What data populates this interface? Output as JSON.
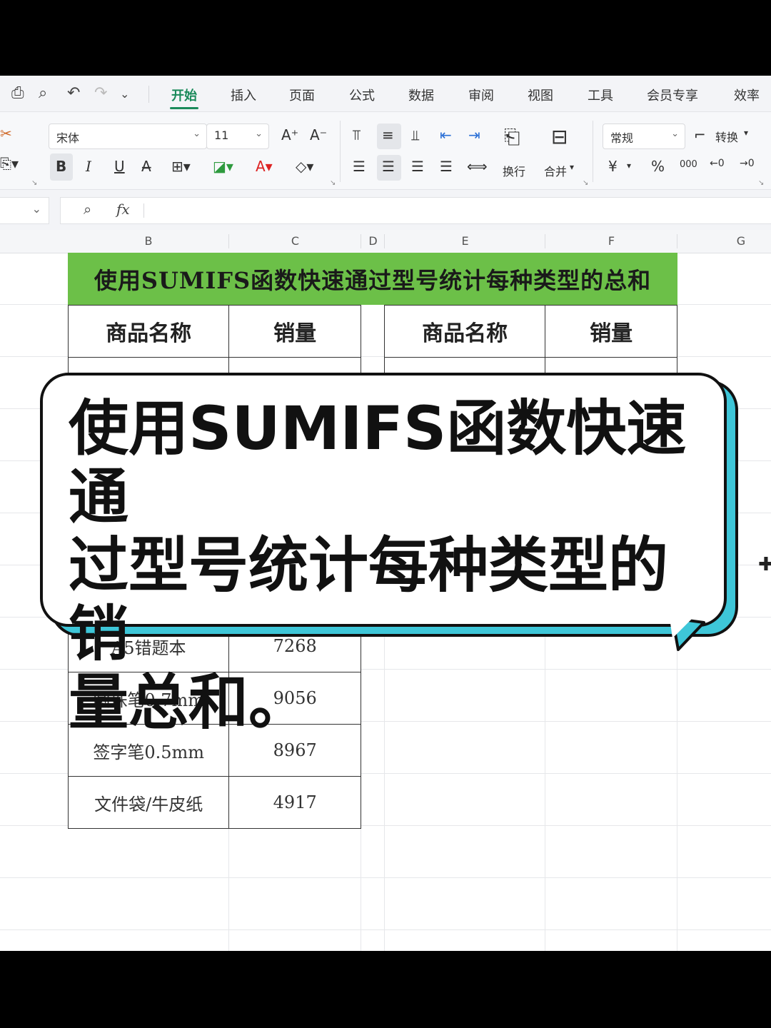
{
  "menu": {
    "tabs": [
      "开始",
      "插入",
      "页面",
      "公式",
      "数据",
      "审阅",
      "视图",
      "工具",
      "会员专享",
      "效率"
    ],
    "active_tab": "开始"
  },
  "ribbon": {
    "font_name": "宋体",
    "font_size": "11",
    "bold": "B",
    "italic": "I",
    "underline": "U",
    "wrap_label": "换行",
    "merge_label": "合并",
    "number_format": "常规",
    "convert_label": "转换",
    "currency": "¥",
    "percent": "%",
    "thousands": "000"
  },
  "formula_bar": {
    "fx_label": "fx",
    "value": ""
  },
  "columns": [
    "B",
    "C",
    "D",
    "E",
    "F",
    "G"
  ],
  "sheet": {
    "title": "使用SUMIFS函数快速通过型号统计每种类型的总和",
    "left_table": {
      "headers": [
        "商品名称",
        "销量"
      ],
      "rows": [
        [
          "A5错题本",
          "7268"
        ],
        [
          "圆珠笔0.7mm",
          "9056"
        ],
        [
          "签字笔0.5mm",
          "8967"
        ],
        [
          "文件袋/牛皮纸",
          "4917"
        ]
      ]
    },
    "right_table": {
      "headers": [
        "商品名称",
        "销量"
      ]
    }
  },
  "overlay": {
    "line1": "使用SUMIFS函数快速通",
    "line2": "过型号统计每种类型的销",
    "line3": "量总和。"
  },
  "colors": {
    "accent_green": "#1a8a5a",
    "title_fill": "#6cc048",
    "bubble_shadow": "#3ec6d8"
  }
}
